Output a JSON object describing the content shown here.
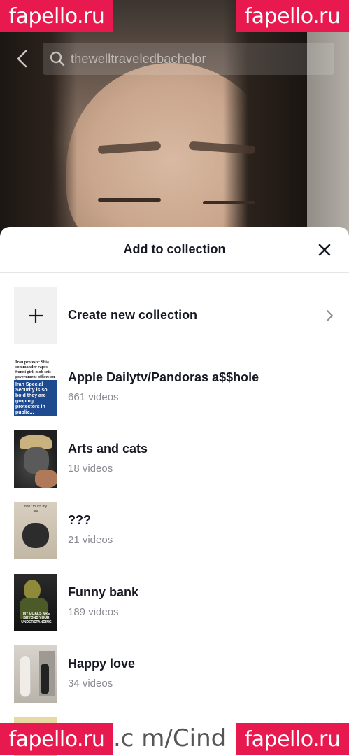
{
  "watermark": {
    "brand": "fapello.ru",
    "middle_text": ".c m/Cind"
  },
  "search": {
    "query": "thewelltraveledbachelor"
  },
  "sheet": {
    "title": "Add to collection",
    "create_label": "Create new collection"
  },
  "collections": [
    {
      "name": "Apple Dailytv/Pandoras a$$hole",
      "count": "661 videos",
      "thumb_text_top": "Iran protests: Shia commander rapes Sunni girl, mob sets government offices on fire",
      "thumb_text_bottom": "Iran Special Security is so bold they are groping protestors in public..."
    },
    {
      "name": "Arts and cats",
      "count": "18 videos"
    },
    {
      "name": "???",
      "count": "21 videos",
      "thumb_text": "don't touch my lap"
    },
    {
      "name": "Funny bank",
      "count": "189 videos",
      "thumb_text": "MY GOALS ARE BEYOND YOUR UNDERSTANDING"
    },
    {
      "name": "Happy love",
      "count": "34 videos"
    }
  ],
  "colors": {
    "watermark_bg": "#e8194f",
    "title_text": "#161823",
    "secondary_text": "#8a8b91"
  }
}
